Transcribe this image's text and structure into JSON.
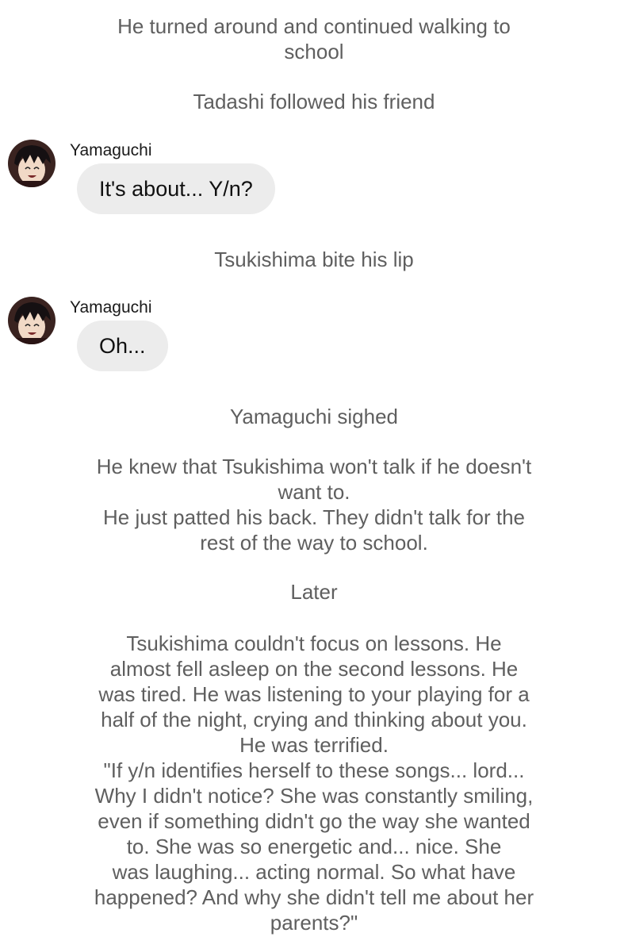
{
  "story": {
    "p1": "He turned around and continued walking to\nschool",
    "p2": "Tadashi followed his friend",
    "p3": "Tsukishima bite his lip",
    "p4": "Yamaguchi sighed",
    "p5": "He knew that Tsukishima won't talk if he doesn't\nwant to.\nHe just patted his back. They didn't talk for the\nrest of the way to school.",
    "p6": "Later",
    "p7": "Tsukishima couldn't focus on lessons. He\nalmost fell asleep on the second lessons. He\nwas tired. He was  listening to your playing for a\nhalf of the night, crying and thinking about you.\nHe was terrified.\n\"If y/n identifies herself to these songs... lord...\nWhy I didn't notice? She was constantly smiling,\neven if something didn't go the way she wanted\nto. She was so energetic and... nice. She\nwas laughing... acting normal. So what have\nhappened? And why she didn't tell me about her\nparents?\""
  },
  "messages": [
    {
      "sender": "Yamaguchi",
      "text": "It's about... Y/n?"
    },
    {
      "sender": "Yamaguchi",
      "text": "Oh..."
    }
  ],
  "colors": {
    "narration": "#5f5f5f",
    "bubble": "#ececec",
    "sender": "#1a1a1a"
  },
  "icons": {
    "avatar": "yamaguchi-avatar"
  }
}
